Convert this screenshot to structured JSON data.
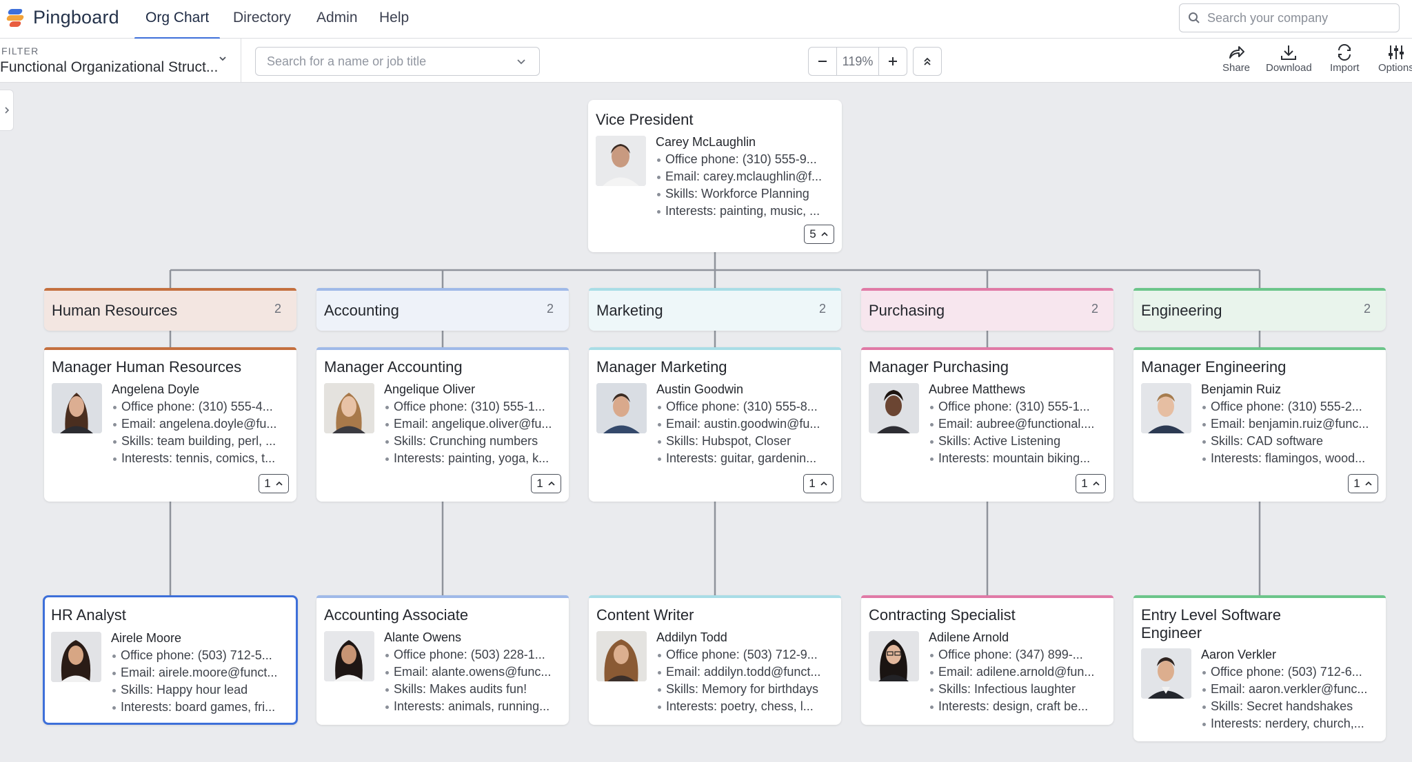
{
  "app": {
    "name": "Pingboard"
  },
  "nav": {
    "tabs": [
      "Org Chart",
      "Directory",
      "Admin",
      "Help"
    ]
  },
  "company_search": {
    "placeholder": "Search your company"
  },
  "filter": {
    "label": "FILTER",
    "value": "Functional Organizational Struct..."
  },
  "name_search": {
    "placeholder": "Search for a name or job title"
  },
  "zoom": {
    "value": "119%"
  },
  "tools": [
    "Share",
    "Download",
    "Import",
    "Options"
  ],
  "colors": {
    "accent_blue": "#3d6fd9",
    "hr": "#c4703f",
    "accounting": "#9fb9e8",
    "marketing": "#a9dde6",
    "purchasing": "#e07aa6",
    "engineering": "#6cc58a"
  },
  "vp": {
    "title": "Vice President",
    "name": "Carey McLaughlin",
    "details": [
      "Office phone: (310) 555-9...",
      "Email: carey.mclaughlin@f...",
      "Skills: Workforce Planning",
      "Interests: painting, music, ..."
    ],
    "count": "5"
  },
  "departments": [
    {
      "name": "Human Resources",
      "count": "2",
      "manager": {
        "title": "Manager Human Resources",
        "name": "Angelena Doyle",
        "details": [
          "Office phone: (310) 555-4...",
          "Email: angelena.doyle@fu...",
          "Skills: team building, perl, ...",
          "Interests: tennis, comics, t..."
        ],
        "count": "1"
      },
      "report": {
        "title": "HR Analyst",
        "name": "Airele Moore",
        "details": [
          "Office phone: (503) 712-5...",
          "Email: airele.moore@funct...",
          "Skills: Happy hour lead",
          "Interests: board games, fri..."
        ]
      }
    },
    {
      "name": "Accounting",
      "count": "2",
      "manager": {
        "title": "Manager Accounting",
        "name": "Angelique Oliver",
        "details": [
          "Office phone: (310) 555-1...",
          "Email: angelique.oliver@fu...",
          "Skills: Crunching numbers",
          "Interests: painting, yoga, k..."
        ],
        "count": "1"
      },
      "report": {
        "title": "Accounting Associate",
        "name": "Alante Owens",
        "details": [
          "Office phone: (503) 228-1...",
          "Email: alante.owens@func...",
          "Skills: Makes audits fun!",
          "Interests: animals, running..."
        ]
      }
    },
    {
      "name": "Marketing",
      "count": "2",
      "manager": {
        "title": "Manager Marketing",
        "name": "Austin Goodwin",
        "details": [
          "Office phone: (310) 555-8...",
          "Email: austin.goodwin@fu...",
          "Skills: Hubspot, Closer",
          "Interests: guitar, gardenin..."
        ],
        "count": "1"
      },
      "report": {
        "title": "Content Writer",
        "name": "Addilyn Todd",
        "details": [
          "Office phone: (503) 712-9...",
          "Email: addilyn.todd@funct...",
          "Skills: Memory for birthdays",
          "Interests: poetry, chess, l..."
        ]
      }
    },
    {
      "name": "Purchasing",
      "count": "2",
      "manager": {
        "title": "Manager Purchasing",
        "name": "Aubree Matthews",
        "details": [
          "Office phone: (310) 555-1...",
          "Email: aubree@functional....",
          "Skills: Active Listening",
          "Interests: mountain biking..."
        ],
        "count": "1"
      },
      "report": {
        "title": "Contracting Specialist",
        "name": "Adilene Arnold",
        "details": [
          "Office phone: (347) 899-...",
          "Email: adilene.arnold@fun...",
          "Skills: Infectious laughter",
          "Interests: design, craft be..."
        ]
      }
    },
    {
      "name": "Engineering",
      "count": "2",
      "manager": {
        "title": "Manager Engineering",
        "name": "Benjamin Ruiz",
        "details": [
          "Office phone: (310) 555-2...",
          "Email: benjamin.ruiz@func...",
          "Skills: CAD software",
          "Interests: flamingos, wood..."
        ],
        "count": "1"
      },
      "report": {
        "title": "Entry Level Software Engineer",
        "name": "Aaron Verkler",
        "details": [
          "Office phone: (503) 712-6...",
          "Email: aaron.verkler@func...",
          "Skills: Secret handshakes",
          "Interests: nerdery, church,..."
        ]
      }
    }
  ]
}
